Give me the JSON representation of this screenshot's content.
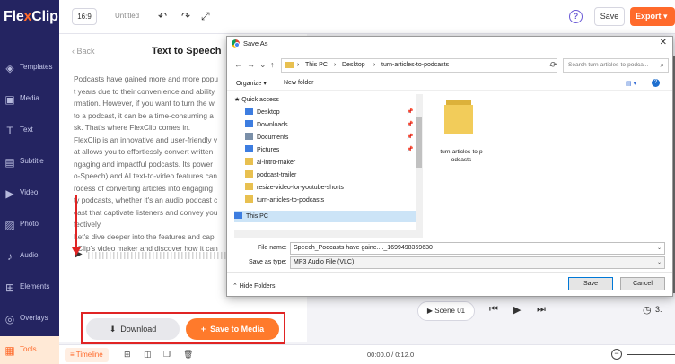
{
  "brand": {
    "name_a": "Fle",
    "name_b": "x",
    "name_c": "Clip"
  },
  "sidebar": {
    "items": [
      {
        "label": "Templates",
        "icon": "templates-icon",
        "glyph": "◈"
      },
      {
        "label": "Media",
        "icon": "media-icon",
        "glyph": "▣"
      },
      {
        "label": "Text",
        "icon": "text-icon",
        "glyph": "T"
      },
      {
        "label": "Subtitle",
        "icon": "subtitle-icon",
        "glyph": "▤"
      },
      {
        "label": "Video",
        "icon": "video-icon",
        "glyph": "▶"
      },
      {
        "label": "Photo",
        "icon": "photo-icon",
        "glyph": "▨"
      },
      {
        "label": "Audio",
        "icon": "audio-icon",
        "glyph": "♪"
      },
      {
        "label": "Elements",
        "icon": "elements-icon",
        "glyph": "⊞"
      },
      {
        "label": "Overlays",
        "icon": "overlays-icon",
        "glyph": "◎"
      },
      {
        "label": "Tools",
        "icon": "tools-icon",
        "glyph": "▦",
        "active": true
      }
    ]
  },
  "topbar": {
    "ratio": "16:9",
    "title": "Untitled",
    "undo_glyph": "↶",
    "redo_glyph": "↷",
    "fullscreen_glyph": "⤢",
    "help_glyph": "?",
    "save": "Save",
    "export": "Export ▾"
  },
  "tts": {
    "back": "‹  Back",
    "title": "Text to Speech",
    "article_lines": [
      "Podcasts have gained more and more popu",
      "t years due to their convenience and ability",
      "rmation. However, if you want to turn the w",
      "to a podcast, it can be a time-consuming a",
      "sk. That's where FlexClip comes in.",
      "FlexClip is an innovative and user-friendly v",
      "at allows you to effortlessly convert written",
      "ngaging and impactful podcasts. Its power",
      "o-Speech) and AI text-to-video features can",
      "rocess of converting articles into engaging",
      "ty podcasts, whether it's an audio podcast c",
      "cast that captivate listeners and convey you",
      "fectively.",
      " Let's dive deeper into the features and cap",
      "xClip's video maker and discover how it can"
    ],
    "play_glyph": "▶",
    "download": "Download",
    "download_glyph": "⬇",
    "save_to_media": "Save to Media",
    "plus_glyph": "+"
  },
  "player": {
    "scene": "▶  Scene 01",
    "prev_glyph": "⏮",
    "play_glyph": "▶",
    "next_glyph": "⏭",
    "clock_glyph": "◷",
    "time_partial": "3."
  },
  "timeline": {
    "tab": "≡  Timeline",
    "add_glyph": "⊞",
    "split_glyph": "◫",
    "copy_glyph": "❐",
    "delete_glyph": "🗑",
    "readout": "00:00.0 / 0:12.0",
    "zoom_minus": "−"
  },
  "dialog": {
    "title": "Save As",
    "close": "✕",
    "back_glyph": "←",
    "forward_glyph": "→",
    "down_glyph": "⌄",
    "up_glyph": "↑",
    "crumbs": [
      "›",
      "This PC",
      "›",
      "Desktop",
      "›",
      "turn-articles-to-podcasts"
    ],
    "addr_dd": "⌄",
    "refresh_glyph": "⟳",
    "search_placeholder": "Search turn-articles-to-podca...",
    "search_glyph": "⌕",
    "organize": "Organize ▾",
    "new_folder": "New folder",
    "view_glyph": "▤ ▾",
    "help_glyph": "?",
    "tree": [
      {
        "label": "★ Quick access",
        "icon": "star",
        "indent": 0
      },
      {
        "label": "Desktop",
        "icon": "blue",
        "indent": 1,
        "pin": true
      },
      {
        "label": "Downloads",
        "icon": "blue",
        "indent": 1,
        "pin": true
      },
      {
        "label": "Documents",
        "icon": "gray",
        "indent": 1,
        "pin": true
      },
      {
        "label": "Pictures",
        "icon": "blue",
        "indent": 1,
        "pin": true
      },
      {
        "label": "ai-intro-maker",
        "icon": "yellow",
        "indent": 1
      },
      {
        "label": "podcast-trailer",
        "icon": "yellow",
        "indent": 1
      },
      {
        "label": "resize-video-for-youtube-shorts",
        "icon": "yellow",
        "indent": 1
      },
      {
        "label": "turn-articles-to-podcasts",
        "icon": "yellow",
        "indent": 1
      },
      {
        "label": "This PC",
        "icon": "blue",
        "indent": 0,
        "selected": true
      }
    ],
    "pin_glyph": "📌",
    "folder_label_1": "turn-articles-to-p",
    "folder_label_2": "odcasts",
    "file_name_label": "File name:",
    "file_name_value": "Speech_Podcasts have gaine...._1699498369630",
    "save_type_label": "Save as type:",
    "save_type_value": "MP3 Audio File (VLC)",
    "dd_glyph": "⌄",
    "hide_folders": "⌃  Hide Folders",
    "save": "Save",
    "cancel": "Cancel"
  },
  "colors": {
    "accent": "#ff6a2b",
    "sidebar": "#242461",
    "highlight": "#e02424"
  }
}
